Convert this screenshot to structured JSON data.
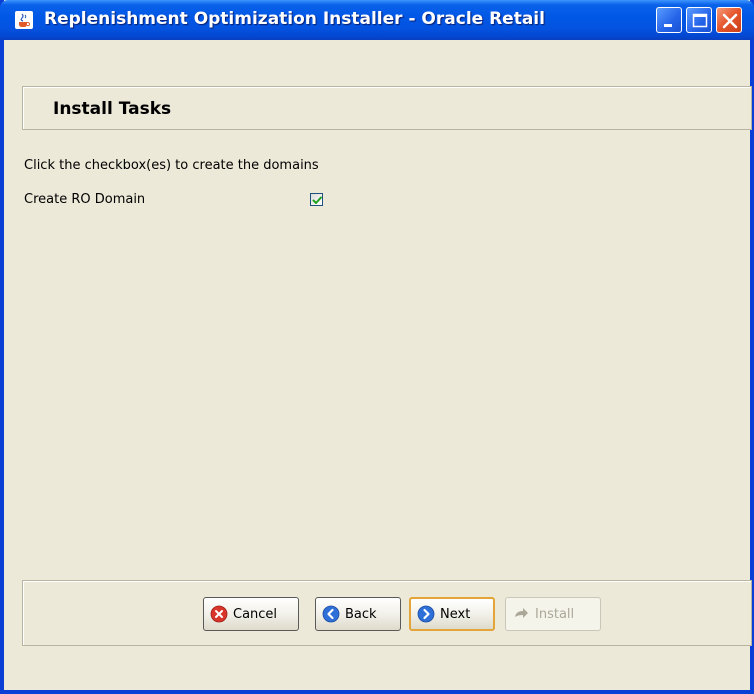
{
  "window": {
    "title": "Replenishment Optimization Installer - Oracle Retail"
  },
  "header": {
    "title": "Install Tasks"
  },
  "main": {
    "instructions": "Click the checkbox(es) to create the domains",
    "domain_option": {
      "label": "Create RO Domain",
      "checked": true
    }
  },
  "footer": {
    "buttons": {
      "cancel": "Cancel",
      "back": "Back",
      "next": "Next",
      "install": "Install"
    }
  },
  "icons": {
    "title": "java-cup-icon",
    "cancel": "cancel-x-icon",
    "back": "back-arrow-icon",
    "next": "next-arrow-icon",
    "install": "install-arrow-icon"
  },
  "colors": {
    "titlebar": "#0058e6",
    "window_bg": "#ece9d8",
    "check": "#21a121",
    "next_focus_border": "#e3a53a"
  }
}
